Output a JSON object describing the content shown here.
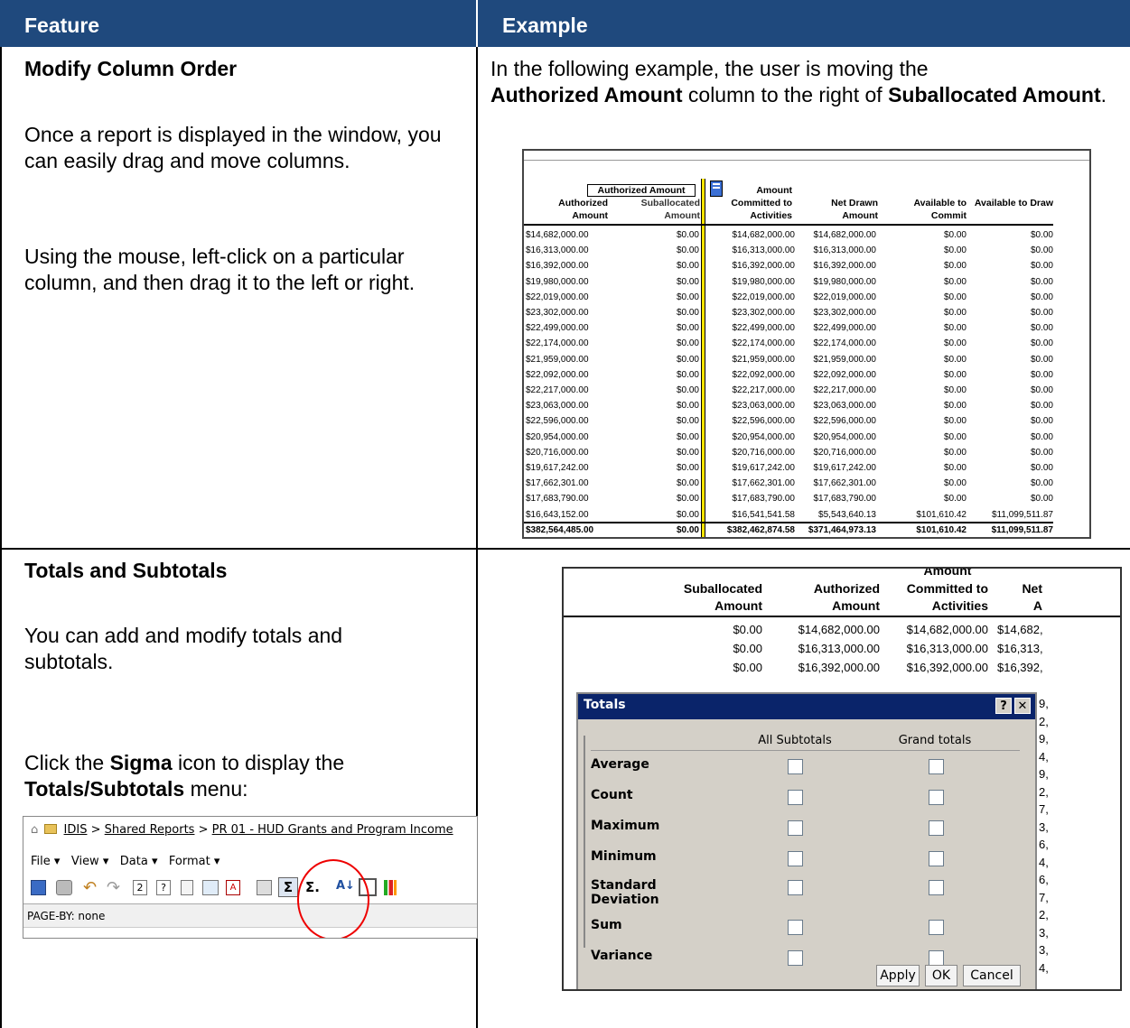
{
  "header": {
    "col1": "Feature",
    "col2": "Example"
  },
  "section1": {
    "title": "Modify Column Order",
    "para1": "Once a report is displayed in the window, you can easily drag and move columns.",
    "para2": "Using the mouse, left-click on a particular column, and then drag it to the left or right.",
    "example": {
      "t1": "In the following example, the user is moving the",
      "b1": "Authorized Amount",
      "t2": " column to the right of ",
      "b2": "Suballocated Amount",
      "t3": "."
    },
    "report": {
      "drag_label": "Authorized Amount",
      "headers": [
        "Authorized Amount",
        "Suballocated Amount",
        "Amount Committed to Activities",
        "Net Drawn Amount",
        "Available to Commit",
        "Available to Draw"
      ],
      "rows": [
        [
          "$14,682,000.00",
          "$0.00",
          "$14,682,000.00",
          "$14,682,000.00",
          "$0.00",
          "$0.00"
        ],
        [
          "$16,313,000.00",
          "$0.00",
          "$16,313,000.00",
          "$16,313,000.00",
          "$0.00",
          "$0.00"
        ],
        [
          "$16,392,000.00",
          "$0.00",
          "$16,392,000.00",
          "$16,392,000.00",
          "$0.00",
          "$0.00"
        ],
        [
          "$19,980,000.00",
          "$0.00",
          "$19,980,000.00",
          "$19,980,000.00",
          "$0.00",
          "$0.00"
        ],
        [
          "$22,019,000.00",
          "$0.00",
          "$22,019,000.00",
          "$22,019,000.00",
          "$0.00",
          "$0.00"
        ],
        [
          "$23,302,000.00",
          "$0.00",
          "$23,302,000.00",
          "$23,302,000.00",
          "$0.00",
          "$0.00"
        ],
        [
          "$22,499,000.00",
          "$0.00",
          "$22,499,000.00",
          "$22,499,000.00",
          "$0.00",
          "$0.00"
        ],
        [
          "$22,174,000.00",
          "$0.00",
          "$22,174,000.00",
          "$22,174,000.00",
          "$0.00",
          "$0.00"
        ],
        [
          "$21,959,000.00",
          "$0.00",
          "$21,959,000.00",
          "$21,959,000.00",
          "$0.00",
          "$0.00"
        ],
        [
          "$22,092,000.00",
          "$0.00",
          "$22,092,000.00",
          "$22,092,000.00",
          "$0.00",
          "$0.00"
        ],
        [
          "$22,217,000.00",
          "$0.00",
          "$22,217,000.00",
          "$22,217,000.00",
          "$0.00",
          "$0.00"
        ],
        [
          "$23,063,000.00",
          "$0.00",
          "$23,063,000.00",
          "$23,063,000.00",
          "$0.00",
          "$0.00"
        ],
        [
          "$22,596,000.00",
          "$0.00",
          "$22,596,000.00",
          "$22,596,000.00",
          "$0.00",
          "$0.00"
        ],
        [
          "$20,954,000.00",
          "$0.00",
          "$20,954,000.00",
          "$20,954,000.00",
          "$0.00",
          "$0.00"
        ],
        [
          "$20,716,000.00",
          "$0.00",
          "$20,716,000.00",
          "$20,716,000.00",
          "$0.00",
          "$0.00"
        ],
        [
          "$19,617,242.00",
          "$0.00",
          "$19,617,242.00",
          "$19,617,242.00",
          "$0.00",
          "$0.00"
        ],
        [
          "$17,662,301.00",
          "$0.00",
          "$17,662,301.00",
          "$17,662,301.00",
          "$0.00",
          "$0.00"
        ],
        [
          "$17,683,790.00",
          "$0.00",
          "$17,683,790.00",
          "$17,683,790.00",
          "$0.00",
          "$0.00"
        ],
        [
          "$16,643,152.00",
          "$0.00",
          "$16,541,541.58",
          "$5,543,640.13",
          "$101,610.42",
          "$11,099,511.87"
        ]
      ],
      "totals": [
        "$382,564,485.00",
        "$0.00",
        "$382,462,874.58",
        "$371,464,973.13",
        "$101,610.42",
        "$11,099,511.87"
      ]
    }
  },
  "section2": {
    "title": "Totals and Subtotals",
    "para1": "You can add and modify totals and subtotals.",
    "p2_t1": "Click the ",
    "p2_b1": "Sigma",
    "p2_t2": " icon to display the ",
    "p2_b2": "Totals/Subtotals",
    "p2_t3": " menu:",
    "toolbar": {
      "breadcrumb": [
        "IDIS",
        "Shared Reports",
        "PR 01 - HUD Grants and Program Income"
      ],
      "sep": ">",
      "menus": [
        "File",
        "View",
        "Data",
        "Format"
      ],
      "pageby": "PAGE-BY: none"
    },
    "report2": {
      "amount_top": "Amount",
      "headers": [
        [
          "Suballocated",
          "Amount"
        ],
        [
          "Authorized",
          "Amount"
        ],
        [
          "Committed to",
          "Activities"
        ],
        [
          "Net",
          "A"
        ]
      ],
      "rows": [
        [
          "$0.00",
          "$14,682,000.00",
          "$14,682,000.00",
          "$14,682,"
        ],
        [
          "$0.00",
          "$16,313,000.00",
          "$16,313,000.00",
          "$16,313,"
        ],
        [
          "$0.00",
          "$16,392,000.00",
          "$16,392,000.00",
          "$16,392,"
        ]
      ],
      "side": [
        "9,",
        "2,",
        "9,",
        "4,",
        "9,",
        "2,",
        "7,",
        "3,",
        "6,",
        "4,",
        "6,",
        "7,",
        "2,",
        "3,",
        "3,",
        "4,"
      ]
    },
    "dialog": {
      "title": "Totals",
      "help": "?",
      "close": "✕",
      "col_headers": [
        "All Subtotals",
        "Grand totals"
      ],
      "items": [
        "Average",
        "Count",
        "Maximum",
        "Minimum",
        "Standard Deviation",
        "Sum",
        "Variance"
      ],
      "buttons": [
        "Apply",
        "OK",
        "Cancel"
      ]
    }
  }
}
